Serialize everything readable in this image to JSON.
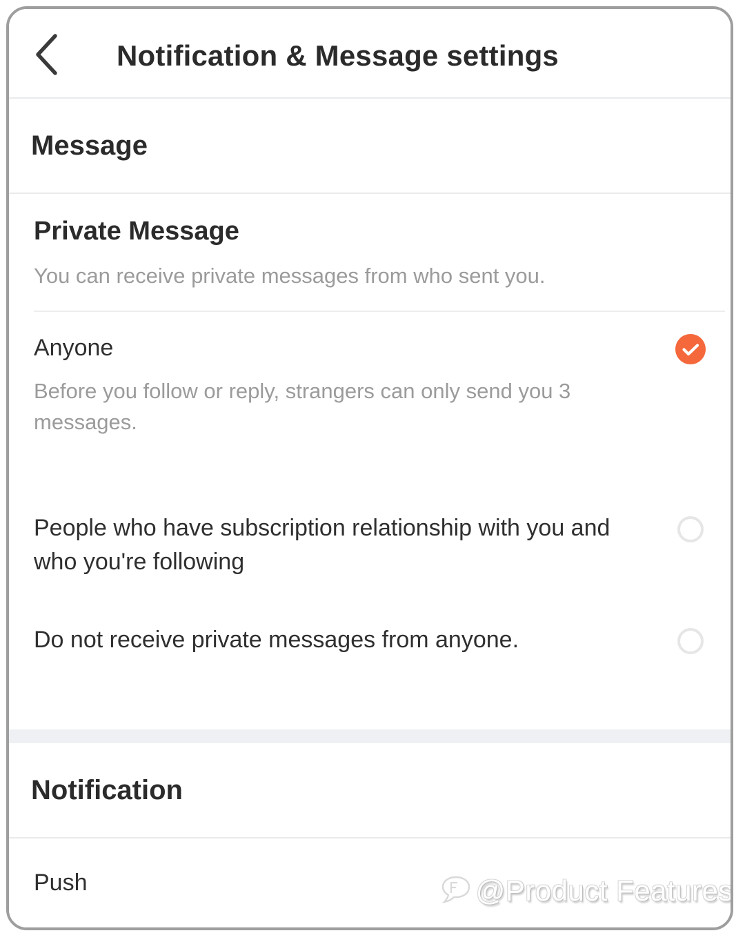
{
  "header": {
    "title": "Notification & Message settings",
    "back_icon": "chevron-left-icon"
  },
  "sections": [
    {
      "key": "message",
      "title": "Message",
      "info": {
        "title": "Private Message",
        "subtitle": "You can receive private messages from who sent you."
      },
      "options": [
        {
          "label": "Anyone",
          "description": "Before you follow or reply, strangers can only send you 3 messages.",
          "selected": true,
          "icon": "check-circle-filled-icon"
        },
        {
          "label": "People who have subscription relationship with you and who you're following",
          "description": "",
          "selected": false,
          "icon": "radio-empty-icon"
        },
        {
          "label": "Do not receive private messages from anyone.",
          "description": "",
          "selected": false,
          "icon": "radio-empty-icon"
        }
      ]
    },
    {
      "key": "notification",
      "title": "Notification",
      "rows": [
        {
          "label": "Push"
        }
      ]
    }
  ],
  "watermark": {
    "text": "@Product Features",
    "mark_icon": "speech-bubble-icon"
  },
  "colors": {
    "accent": "#f4683b",
    "text_primary": "#2b2b2b",
    "text_secondary": "#9b9b9b",
    "divider": "#e9eaec",
    "band": "#eef0f4",
    "radio_off": "#e6e6e6",
    "frame": "#9e9e9e"
  }
}
